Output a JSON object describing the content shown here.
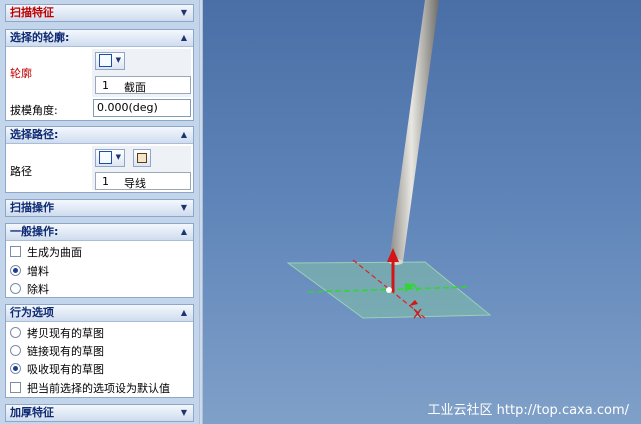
{
  "panel": {
    "sweep_feature": {
      "title": "扫描特征"
    },
    "select_profile": {
      "title": "选择的轮廓:",
      "profile_label": "轮廓",
      "profile_item_index": "1",
      "profile_item_name": "截面",
      "draft_label": "拔模角度:",
      "draft_value": "0.000(deg)"
    },
    "select_path": {
      "title": "选择路径:",
      "path_label": "路径",
      "path_item_index": "1",
      "path_item_name": "导线"
    },
    "sweep_operation": {
      "title": "扫描操作"
    },
    "general_operation": {
      "title": "一般操作:",
      "create_surface": "生成为曲面",
      "add_material": "增料",
      "remove_material": "除料"
    },
    "behavior_options": {
      "title": "行为选项",
      "copy_sketch": "拷贝现有的草图",
      "link_sketch": "链接现有的草图",
      "absorb_sketch": "吸收现有的草图",
      "set_default": "把当前选择的选项设为默认值"
    },
    "thicken_feature": {
      "title": "加厚特征"
    }
  },
  "viewport": {
    "watermark": "工业云社区 http://top.caxa.com/"
  },
  "colors": {
    "accent_red": "#c00000",
    "header_blue": "#0e2a73",
    "viewport_top": "#4a6fa6",
    "viewport_bottom": "#7fa0c8"
  }
}
